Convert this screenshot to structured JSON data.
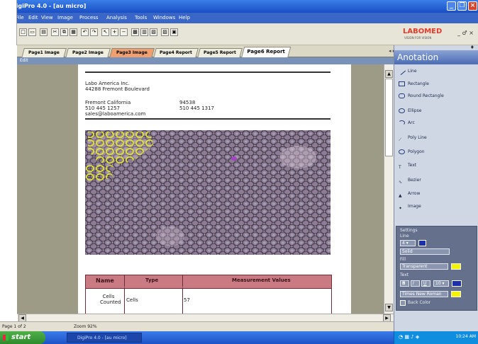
{
  "window": {
    "title": "DigiPro 4.0 - [au micro]"
  },
  "menu": [
    "File",
    "Edit",
    "View",
    "Image",
    "Process",
    "Analysis",
    "Tools",
    "Windows",
    "Help"
  ],
  "brand": {
    "logo": "LABOMED",
    "tagline": "VISION FOR VISION"
  },
  "doc_controls": "_ ♂ ×",
  "tabs": [
    {
      "label": "Page1 Image",
      "style": "normal"
    },
    {
      "label": "Page2 Image",
      "style": "normal"
    },
    {
      "label": "Page3 Image",
      "style": "orange"
    },
    {
      "label": "Page4 Report",
      "style": "normal"
    },
    {
      "label": "Page5 Report",
      "style": "normal"
    },
    {
      "label": "Page6 Report",
      "style": "active"
    }
  ],
  "tab_nav": "◂ ▸ ×",
  "edit_label": "Edit",
  "report": {
    "company": "Labo America Inc.",
    "address": "44288 Fremont Boulevard",
    "city": "Fremont California",
    "zip": "94538",
    "phone": "510 445 1257",
    "fax": "510 445 1317",
    "email": "sales@laboamerica.com",
    "table": {
      "headers": [
        "Name",
        "Type",
        "Measurement Values"
      ],
      "rows": [
        {
          "name": "Cells Counted",
          "type": "Cells",
          "value": "57"
        }
      ]
    }
  },
  "status": {
    "page": "Page 1 of 2",
    "zoom": "Zoom 92%"
  },
  "panel": {
    "title": "Anotation",
    "tools": [
      "Line",
      "Rectangle",
      "Round Rectangle",
      "Ellipse",
      "Arc",
      "Poly Line",
      "Polygon",
      "Text",
      "Bezier",
      "Arrow",
      "Image"
    ],
    "settings": {
      "group": "Settings",
      "line_group": "Line",
      "line_width": "4",
      "line_style": "Solid",
      "fill_group": "Fill",
      "fill_value": "Transparent",
      "text_group": "Text",
      "bold": "B",
      "italic": "I",
      "underline": "U",
      "font_size": "10",
      "font_name": "Times New Roman",
      "back_color_label": "Back Color"
    },
    "colors": {
      "line": "#1b2fa8",
      "fill": "#f4f400",
      "text": "#1b2fa8",
      "text2": "#f4f400"
    }
  },
  "taskbar": {
    "start": "start",
    "app": "DigiPro 4.0 - [au micro]",
    "clock": "10:24 AM"
  }
}
